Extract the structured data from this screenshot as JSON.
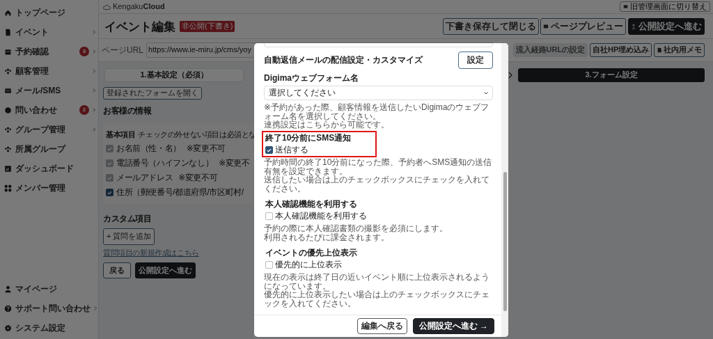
{
  "sidebar": {
    "items": [
      {
        "label": "トップページ",
        "expandable": false
      },
      {
        "label": "イベント",
        "expandable": true
      },
      {
        "label": "予約確認",
        "badge": "3",
        "expandable": true
      },
      {
        "label": "顧客管理",
        "expandable": true
      },
      {
        "label": "メール/SMS",
        "expandable": true
      },
      {
        "label": "問い合わせ",
        "badge": "2",
        "expandable": true
      },
      {
        "label": "グループ管理",
        "expandable": true
      },
      {
        "label": "所属グループ",
        "expandable": false
      },
      {
        "label": "ダッシュボード",
        "expandable": false
      },
      {
        "label": "メンバー管理",
        "expandable": false
      }
    ],
    "bottom_items": [
      {
        "label": "マイページ",
        "expandable": false
      },
      {
        "label": "サポート問い合わせ",
        "expandable": true
      },
      {
        "label": "システム設定",
        "expandable": false
      }
    ]
  },
  "header": {
    "logo_light": "Kengaku",
    "logo_bold": "Cloud",
    "switch_button": "旧管理画面に切り替え"
  },
  "page": {
    "title": "イベント編集",
    "status_badge": "非公開(下書き)",
    "actions": [
      {
        "label": "下書き保存して閉じる",
        "kind": "outline"
      },
      {
        "label": "ページプレビュー",
        "kind": "preview"
      },
      {
        "label": "公開設定へ進む",
        "kind": "primary"
      }
    ],
    "url_label": "ページURL",
    "url_value": "https://www.ie-miru.jp/cms/yoy",
    "url_actions": [
      {
        "label": "流入経路URLの設定",
        "disabled": true,
        "kind": "plain"
      },
      {
        "label": "自社HP埋め込み",
        "disabled": false,
        "kind": "plain"
      },
      {
        "label": "社内用メモ",
        "disabled": false,
        "kind": "memo"
      }
    ],
    "steps": [
      {
        "label": "1.基本設定（必須）",
        "selected": false
      },
      {
        "label": "3.フォーム設定",
        "selected": true
      }
    ],
    "open_form_button": "登録されたフォームを開く",
    "customer_heading": "お客様の情報",
    "basic_title": "基本項目",
    "basic_note": "チェックの外せない項目は必須とな",
    "fields": [
      {
        "label": "お名前（性・名）",
        "note": "※変更不可",
        "checked": true,
        "disabled": true
      },
      {
        "label": "電話番号（ハイフンなし）",
        "note": "※変更不",
        "checked": true,
        "disabled": true
      },
      {
        "label": "メールアドレス",
        "note": "※変更不可",
        "checked": true,
        "disabled": true
      },
      {
        "label": "住所（郵便番号/都道府県/市区町村/",
        "checked": true,
        "disabled": false
      }
    ],
    "custom_heading": "カスタム項目",
    "add_question": "+ 質問を追加",
    "new_question_link": "質問項目の新規作成はこちら",
    "back_button": "戻る",
    "next_button": "公開設定へ進む"
  },
  "modal": {
    "auto_reply_label": "自動返信メールの配信設定・カスタマイズ",
    "auto_reply_button": "設定",
    "digima_label": "Digimaウェブフォーム名",
    "digima_select": "選択してください",
    "digima_help": "※予約があった際、顧客情報を送信したいDigimaのウェブフォーム名を選択してください。",
    "digima_link_before": "連携設定は",
    "digima_link": "こちら",
    "digima_link_after": "から可能です。",
    "options": [
      {
        "title": "終了10分前にSMS通知",
        "checkbox": "送信する",
        "checked": true,
        "highlighted": true,
        "help": [
          "予約時間の終了10分前になった際、予約者へSMS通知の送信有無を設定できます。",
          "送信したい場合は上のチェックボックスにチェックを入れてください。"
        ]
      },
      {
        "title": "本人確認機能を利用する",
        "checkbox": "本人確認機能を利用する",
        "checked": false,
        "highlighted": false,
        "help": [
          "予約の際に本人確認書類の撮影を必須にします。",
          "利用されるたびに課金されます。"
        ]
      },
      {
        "title": "イベントの優先上位表示",
        "checkbox": "優先的に上位表示",
        "checked": false,
        "highlighted": false,
        "help": [
          "現在の表示は終了日の近いイベント順に上位表示されるようになっています。",
          "優先的に上位表示したい場合は上のチェックボックスにチェックを入れてください。"
        ]
      }
    ],
    "back_button": "編集へ戻る",
    "next_button": "公開設定へ進む →"
  }
}
